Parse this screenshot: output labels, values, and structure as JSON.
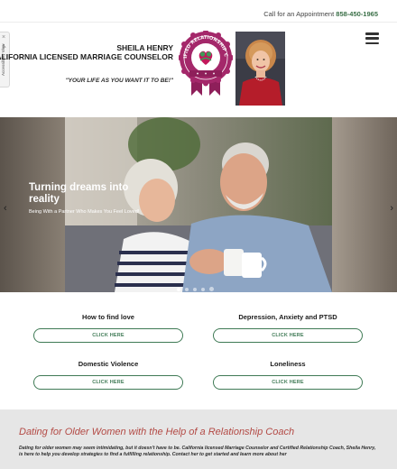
{
  "topbar": {
    "call_label": "Call for an Appointment",
    "phone": "858-450-1965"
  },
  "accessibility": {
    "close_icon": "close-icon",
    "label": "Accessibility View",
    "icon": "accessibility-icon"
  },
  "header": {
    "name": "SHEILA HENRY",
    "title": "CALIFORNIA LICENSED MARRIAGE COUNSELOR",
    "tagline": "\"YOUR LIFE AS YOU WANT IT TO BE!\"",
    "seal_text": "CERTIFIED RELATIONSHIP COACH",
    "menu_icon": "hamburger-menu-icon"
  },
  "hero": {
    "heading": "Turning dreams into reality",
    "subtext": "Being With a Partner Who Makes You Feel Loved!",
    "prev_icon": "chevron-left-icon",
    "next_icon": "chevron-right-icon",
    "slides_count": 4,
    "active_slide": 1
  },
  "services": [
    {
      "title": "How to find love",
      "button": "CLICK HERE"
    },
    {
      "title": "Depression, Anxiety and PTSD",
      "button": "CLICK HERE"
    },
    {
      "title": "Domestic Violence",
      "button": "CLICK HERE"
    },
    {
      "title": "Loneliness",
      "button": "CLICK HERE"
    }
  ],
  "intro": {
    "heading": "Dating for Older Women with the Help of a Relationship Coach",
    "body": "Dating for older women may seem intimidating, but it doesn't have to be. California licensed Marriage Counselor and Certified Relationship Coach, Sheila Henry, is here to help you develop strategies to find a fulfilling relationship. Contact her to get started and learn more about her"
  },
  "colors": {
    "brand_green": "#3f7a55",
    "seal_magenta": "#a4286a",
    "heading_red": "#b34a45",
    "intro_bg": "#e6e6e6"
  }
}
